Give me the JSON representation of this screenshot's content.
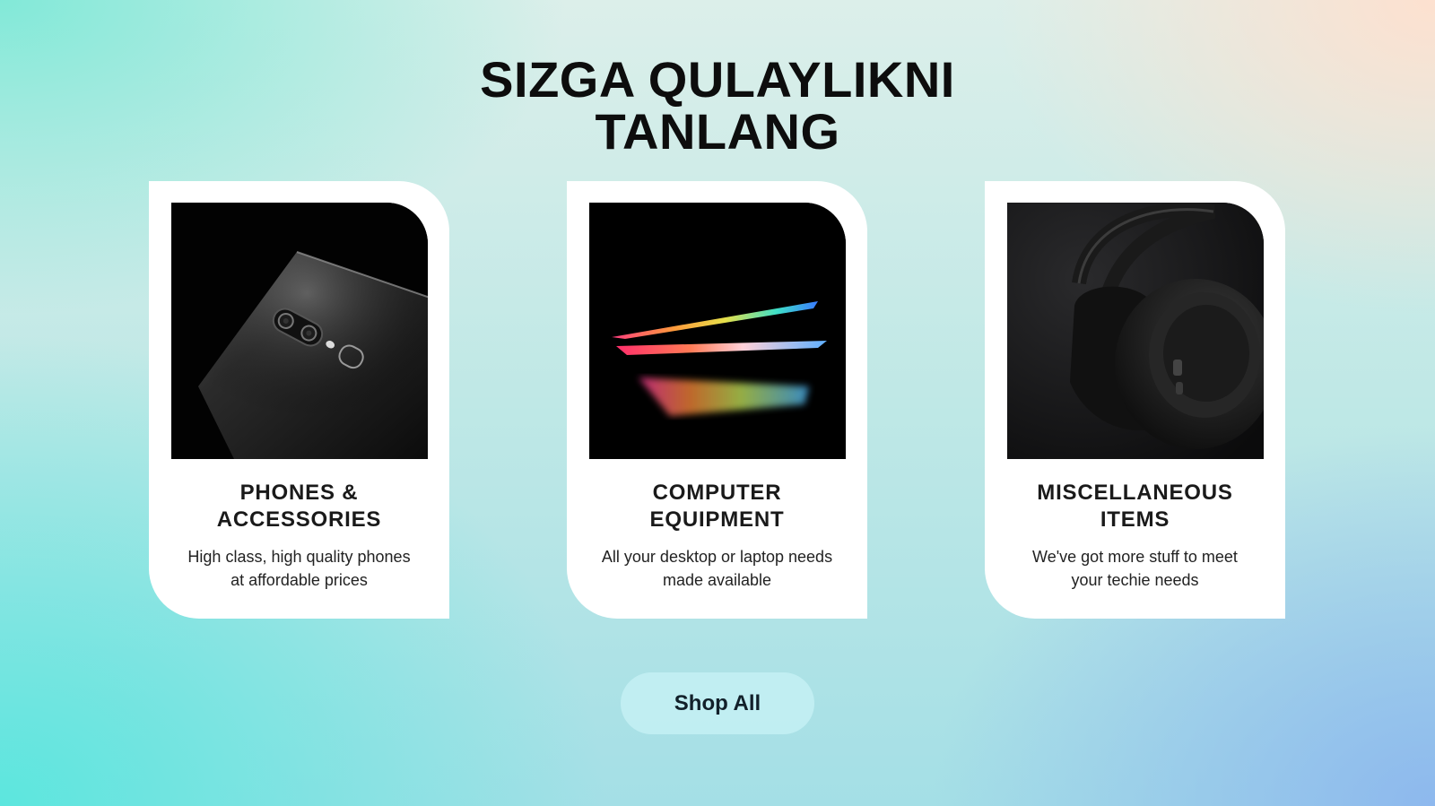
{
  "heading": {
    "line1": "SIZGA QULAYLIKNI",
    "line2": "TANLANG"
  },
  "cards": [
    {
      "title_line1": "PHONES &",
      "title_line2": "ACCESSORIES",
      "desc_line1": "High class, high quality phones",
      "desc_line2": "at affordable prices",
      "image": "phone-photo"
    },
    {
      "title_line1": "COMPUTER",
      "title_line2": "EQUIPMENT",
      "desc_line1": "All your desktop or laptop needs",
      "desc_line2": "made available",
      "image": "laptop-photo"
    },
    {
      "title_line1": "MISCELLANEOUS",
      "title_line2": "ITEMS",
      "desc_line1": "We've got more stuff to meet",
      "desc_line2": "your techie needs",
      "image": "headphones-photo"
    }
  ],
  "cta": {
    "label": "Shop All"
  },
  "colors": {
    "card_bg": "#ffffff",
    "text_dark": "#0d0d0d",
    "button_bg": "#c8f2f6"
  }
}
